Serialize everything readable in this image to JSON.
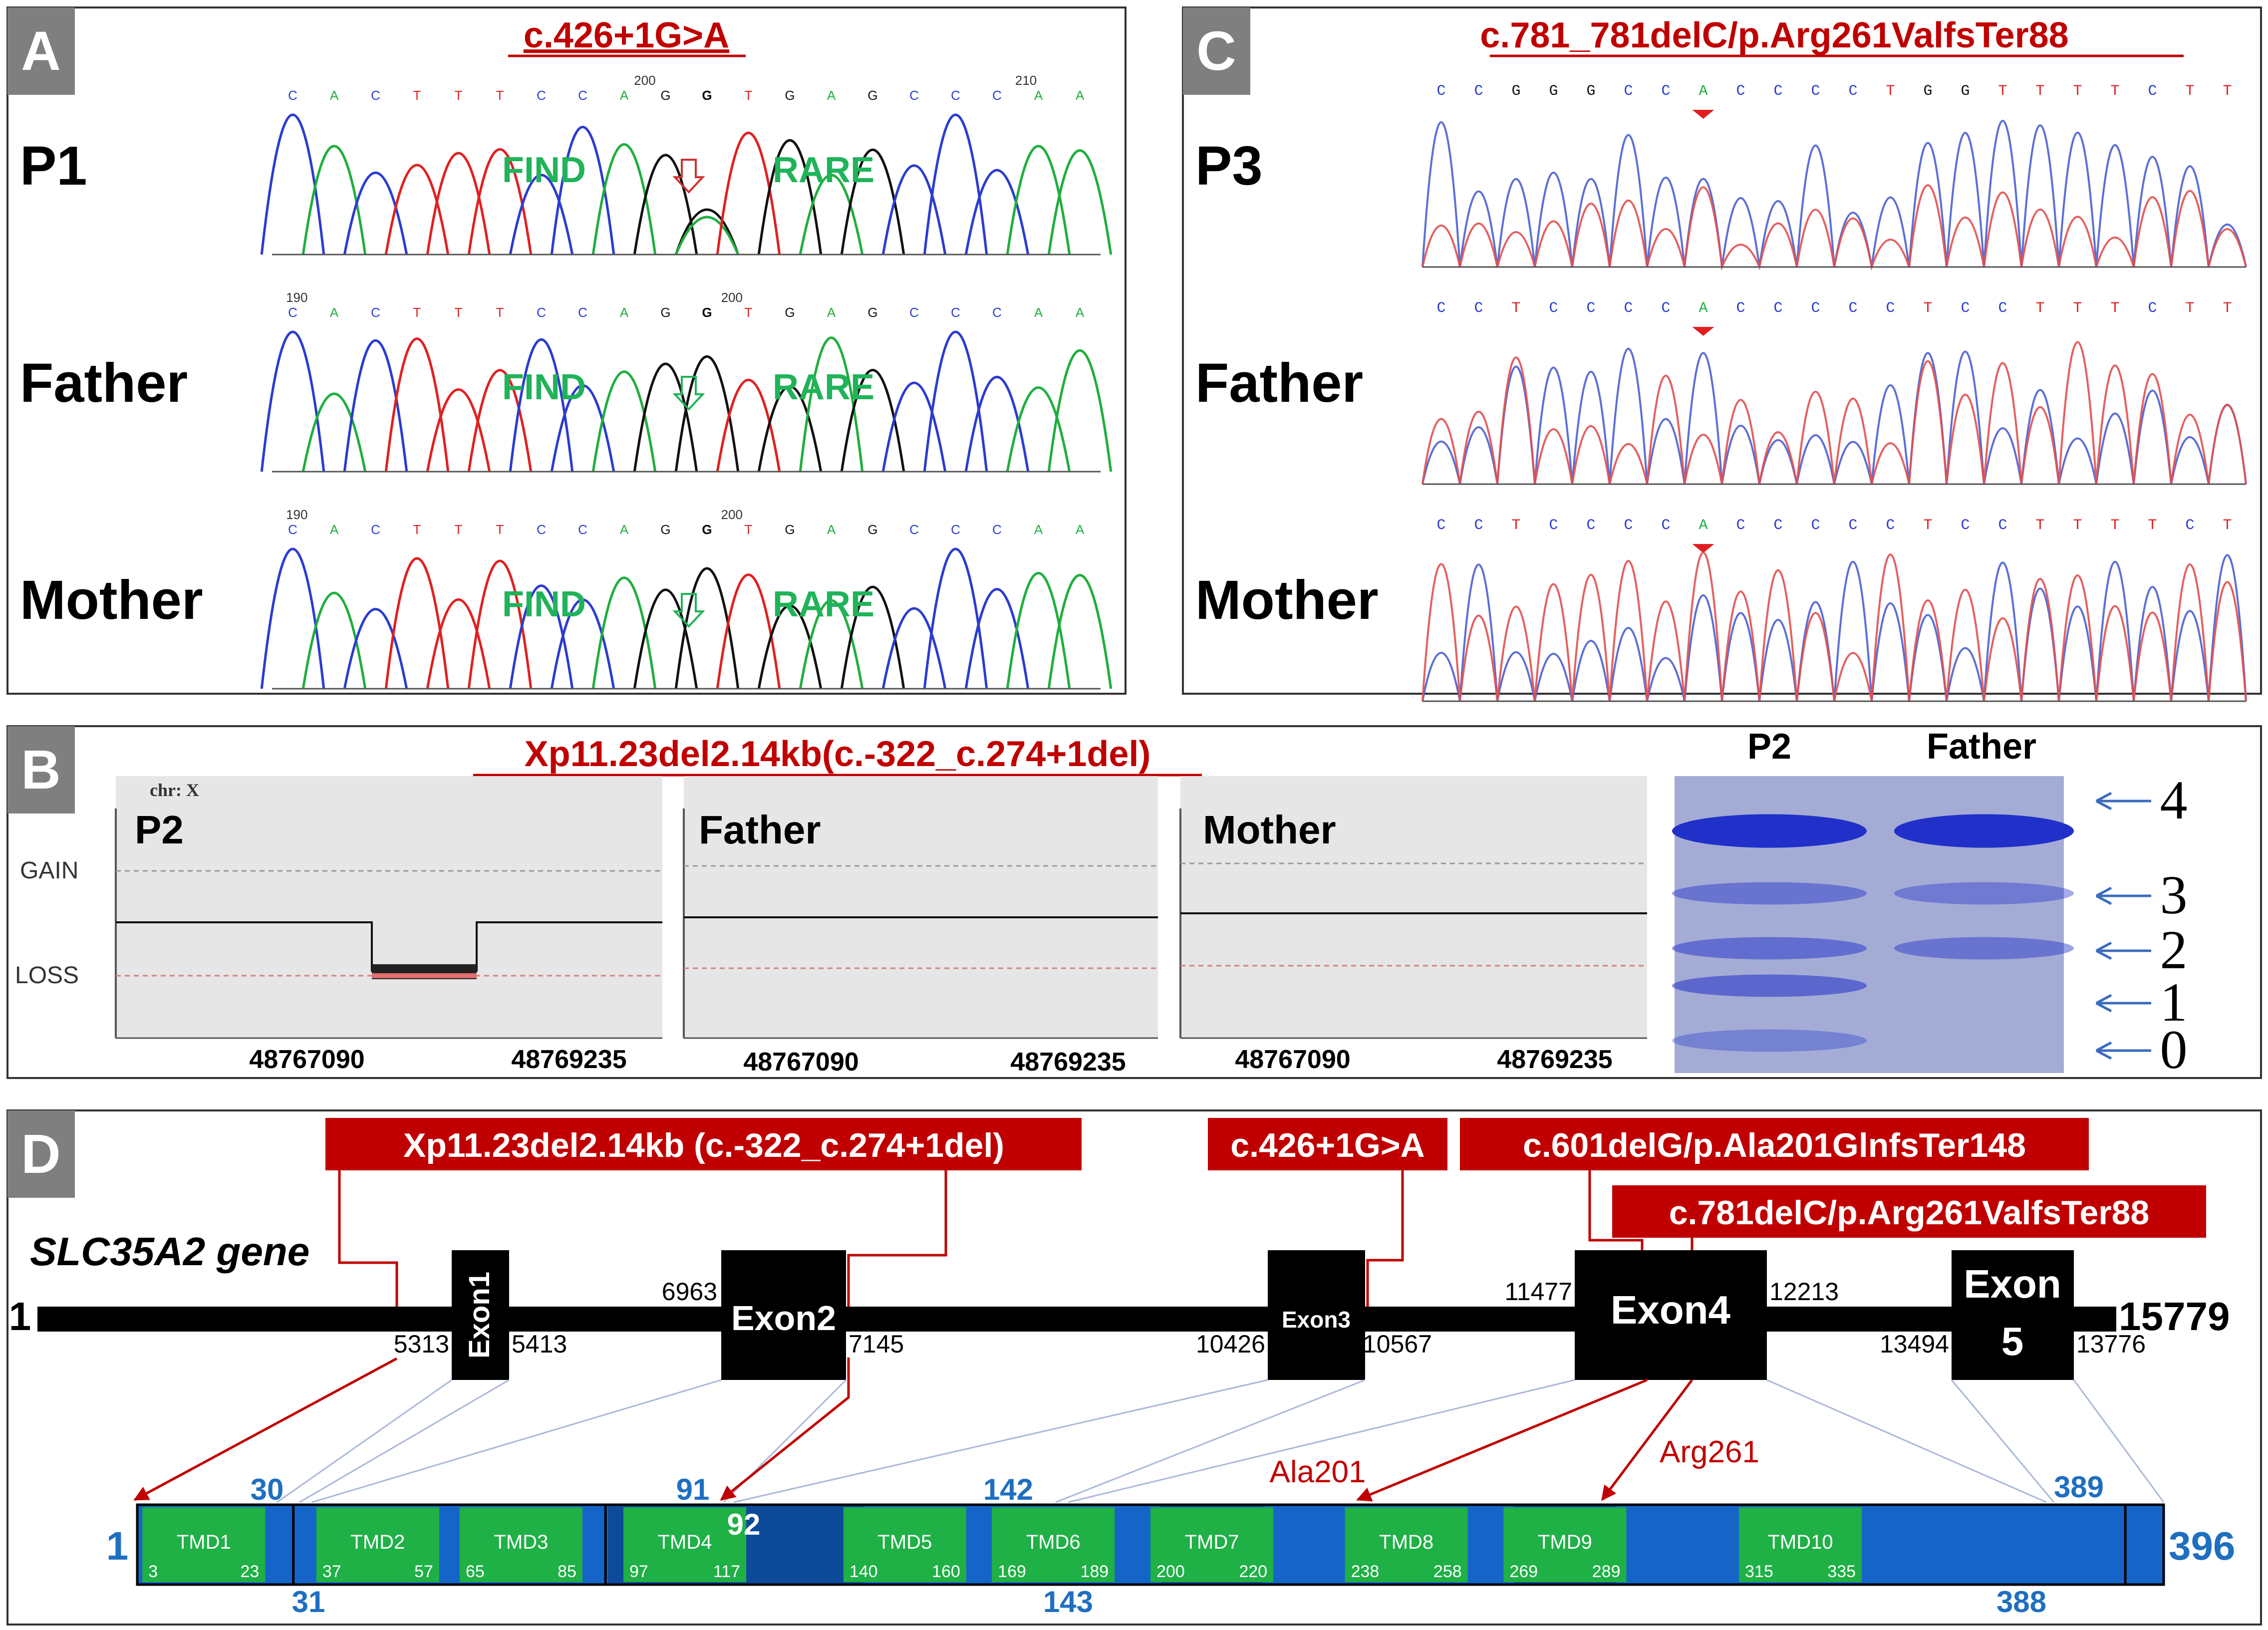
{
  "panel_a": {
    "letter": "A",
    "title": "c.426+1G>A",
    "rows": [
      {
        "label": "P1",
        "seq": "CACTTTCCAGGTGAGCCCAA",
        "pos1": "200",
        "pos2": "210",
        "arrow": "red"
      },
      {
        "label": "Father",
        "seq": "CACTTTCCAGGTGAGCCCAA",
        "pos1": "190",
        "pos2": "200",
        "arrow": "green"
      },
      {
        "label": "Mother",
        "seq": "CACTTTCCAGGTGAGCCCAA",
        "pos1": "190",
        "pos2": "200",
        "arrow": "green"
      }
    ],
    "find_label": "FIND",
    "rare_label": "RARE"
  },
  "panel_c": {
    "letter": "C",
    "title": "c.781_781delC/p.Arg261ValfsTer88",
    "rows": [
      {
        "label": "P3"
      },
      {
        "label": "Father"
      },
      {
        "label": "Mother"
      }
    ]
  },
  "panel_b": {
    "letter": "B",
    "title": "Xp11.23del2.14kb(c.-322_c.274+1del)",
    "chr": "chr: X",
    "gain": "GAIN",
    "loss": "LOSS",
    "plots": [
      {
        "label": "P2",
        "x1": "48767090",
        "x2": "48769235"
      },
      {
        "label": "Father",
        "x1": "48767090",
        "x2": "48769235"
      },
      {
        "label": "Mother",
        "x1": "48767090",
        "x2": "48769235"
      }
    ],
    "gel": {
      "lanes": [
        "P2",
        "Father"
      ],
      "bands": [
        "4",
        "3",
        "2",
        "1",
        "0"
      ],
      "p2_levels": [
        1,
        0.45,
        0.5,
        0.55,
        0.35
      ],
      "father_levels": [
        1,
        0.4,
        0.45,
        0,
        0
      ]
    }
  },
  "panel_d": {
    "letter": "D",
    "gene_label": "SLC35A2 gene",
    "gene_start": "1",
    "gene_end": "15779",
    "mutations": [
      "Xp11.23del2.14kb (c.-322_c.274+1del)",
      "c.426+1G>A",
      "c.601delG/p.Ala201GlnfsTer148",
      "c.781delC/p.Arg261ValfsTer88"
    ],
    "exons": [
      {
        "name": "Exon1",
        "left": "5313",
        "right": "5413"
      },
      {
        "name": "Exon2",
        "left": "6963",
        "right": "7145"
      },
      {
        "name": "Exon3",
        "left": "10426",
        "right": "10567"
      },
      {
        "name": "Exon4",
        "left": "11477",
        "right": "12213"
      },
      {
        "name": "Exon",
        "name2": "5",
        "left": "13494",
        "right": "13776"
      }
    ],
    "protein": {
      "start": "1",
      "end": "396",
      "boundaries_top": [
        "30",
        "91",
        "142",
        "389"
      ],
      "boundaries_bottom": [
        "31",
        "143",
        "388"
      ],
      "b92": "92",
      "ala": "Ala201",
      "arg": "Arg261",
      "tmds": [
        {
          "name": "TMD1",
          "s": "3",
          "e": "23"
        },
        {
          "name": "TMD2",
          "s": "37",
          "e": "57"
        },
        {
          "name": "TMD3",
          "s": "65",
          "e": "85"
        },
        {
          "name": "TMD4",
          "s": "97",
          "e": "117"
        },
        {
          "name": "TMD5",
          "s": "140",
          "e": "160"
        },
        {
          "name": "TMD6",
          "s": "169",
          "e": "189"
        },
        {
          "name": "TMD7",
          "s": "200",
          "e": "220"
        },
        {
          "name": "TMD8",
          "s": "238",
          "e": "258"
        },
        {
          "name": "TMD9",
          "s": "269",
          "e": "289"
        },
        {
          "name": "TMD10",
          "s": "315",
          "e": "335"
        }
      ]
    }
  }
}
